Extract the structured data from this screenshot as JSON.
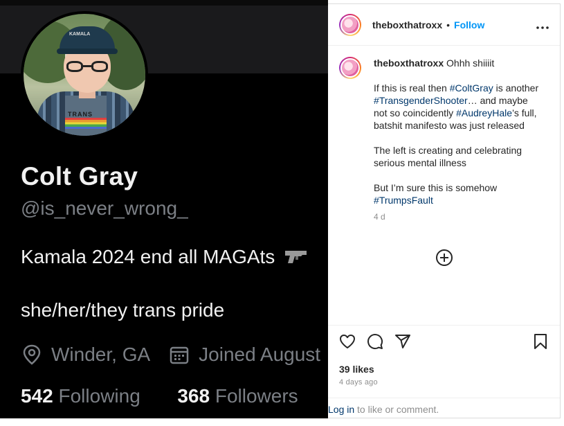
{
  "profile_image": {
    "name": "Colt Gray",
    "handle": "@is_never_wrong_",
    "bio": "Kamala 2024 end all MAGAts",
    "pronouns": "she/her/they trans pride",
    "location": "Winder, GA",
    "joined": "Joined August",
    "following_count": "542",
    "following_label": "Following",
    "followers_count": "368",
    "followers_label": "Followers",
    "hat_text": "KAMALA",
    "shirt_text": "TRANS",
    "icons": [
      "location-pin-icon",
      "calendar-icon",
      "pistol-icon"
    ]
  },
  "post": {
    "username": "theboxthatroxx",
    "separator": "•",
    "follow_label": "Follow",
    "more_label": "•••",
    "caption": {
      "username": "theboxthatroxx",
      "line1_text": "Ohhh shiiiit",
      "p1_a": "If this is real then ",
      "tag_coltgray": "#ColtGray",
      "p1_b": " is another ",
      "tag_transgendershooter": "#TransgenderShooter",
      "p1_c": "… and maybe not so coincidently ",
      "tag_audreyhale": "#AudreyHale",
      "p1_d": "’s full, batshit manifesto was just released",
      "p2": "The left is creating and celebrating serious mental illness",
      "p3_a": "But I’m sure this is somehow ",
      "tag_trumpsfault": "#TrumpsFault",
      "time": "4 d"
    },
    "likes": "39 likes",
    "posted_ago": "4 days ago",
    "login_link": "Log in",
    "login_suffix": " to like or comment.",
    "icons": [
      "heart-icon",
      "comment-icon",
      "share-icon",
      "bookmark-icon",
      "add-circle-icon"
    ]
  },
  "colors": {
    "follow_blue": "#0095f6",
    "hashtag_blue": "#00376b",
    "muted_text": "#8e8e8e",
    "image_bg": "#000000"
  }
}
